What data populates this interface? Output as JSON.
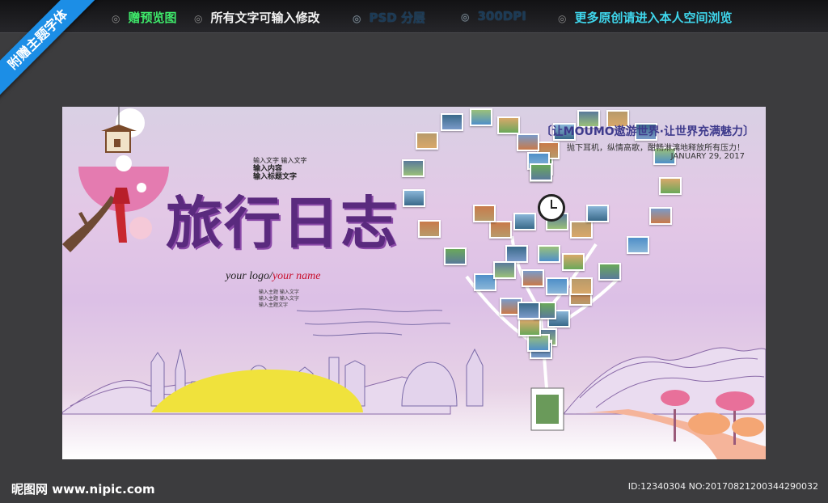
{
  "header": {
    "items": [
      {
        "label": "赠预览图",
        "color": "green"
      },
      {
        "label": "所有文字可输入修改",
        "color": "white"
      },
      {
        "label": "PSD 分层",
        "color": "dim"
      },
      {
        "label": "300DPI",
        "color": "dim"
      },
      {
        "label": "更多原创请进入本人空间浏览",
        "color": "cyan"
      }
    ]
  },
  "ribbon": {
    "label": "附赠主题字体"
  },
  "poster": {
    "slogan": "〔让MOUMO遨游世界·让世界充满魅力〕",
    "subline": "抛下耳机，纵情高歌，酣畅淋漓地释放所有压力！",
    "date": "JANUARY 29, 2017",
    "title": "旅行日志",
    "small_notes": [
      "输入文字 输入文字",
      "输入内容",
      "输入标题文字"
    ],
    "logo_left": "your logo/",
    "logo_right": "your name",
    "tiny_notes": [
      "输入主题 输入文字",
      "输入主题 输入文字",
      "输入主题文字"
    ]
  },
  "footer": {
    "site": "昵图网 www.nipic.com",
    "image_id": "ID:12340304 NO:20170821200344290032"
  },
  "colors": {
    "title": "#5a2a7e",
    "ribbon": "#1c8ee6",
    "sun": "#f0e23c",
    "path": "#f5b49a"
  }
}
